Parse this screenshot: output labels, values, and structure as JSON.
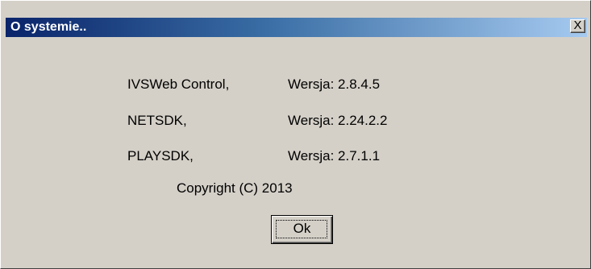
{
  "dialog": {
    "title": "O systemie..",
    "close_label": "X",
    "components": [
      {
        "name": "IVSWeb Control,",
        "version": "Wersja: 2.8.4.5"
      },
      {
        "name": "NETSDK,",
        "version": "Wersja: 2.24.2.2"
      },
      {
        "name": "PLAYSDK,",
        "version": "Wersja: 2.7.1.1"
      }
    ],
    "copyright": "Copyright (C) 2013",
    "ok_label": "Ok"
  },
  "colors": {
    "face": "#d4d0c8",
    "title_start": "#0a246a",
    "title_end": "#a6caf0",
    "title_text": "#ffffff"
  }
}
